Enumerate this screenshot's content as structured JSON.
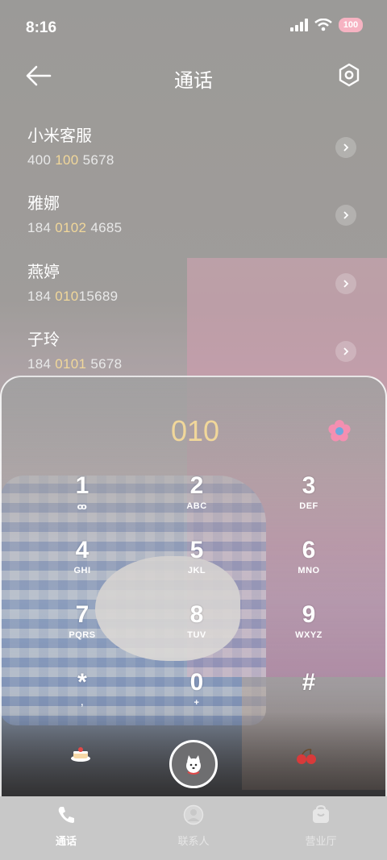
{
  "status_bar": {
    "time": "8:16",
    "battery": "100"
  },
  "header": {
    "title": "通话",
    "back_icon": "arrow-left-icon",
    "settings_icon": "settings-icon"
  },
  "contacts": [
    {
      "name": "小米客服",
      "number_parts": [
        "400 ",
        "100",
        " 5678"
      ]
    },
    {
      "name": "雅娜",
      "number_parts": [
        "184 ",
        "0102",
        " 4685"
      ]
    },
    {
      "name": "燕婷",
      "number_parts": [
        "184 ",
        "010",
        "15689"
      ]
    },
    {
      "name": "子玲",
      "number_parts": [
        "184 ",
        "0101",
        " 5678"
      ]
    }
  ],
  "dialpad": {
    "display": "010",
    "keys": [
      {
        "digit": "1",
        "letters": "ꝏ"
      },
      {
        "digit": "2",
        "letters": "ABC"
      },
      {
        "digit": "3",
        "letters": "DEF"
      },
      {
        "digit": "4",
        "letters": "GHI"
      },
      {
        "digit": "5",
        "letters": "JKL"
      },
      {
        "digit": "6",
        "letters": "MNO"
      },
      {
        "digit": "7",
        "letters": "PQRS"
      },
      {
        "digit": "8",
        "letters": "TUV"
      },
      {
        "digit": "9",
        "letters": "WXYZ"
      },
      {
        "digit": "*",
        "letters": ","
      },
      {
        "digit": "0",
        "letters": "+"
      },
      {
        "digit": "#",
        "letters": ""
      }
    ]
  },
  "tabs": [
    {
      "label": "通话",
      "icon": "phone-icon",
      "active": true
    },
    {
      "label": "联系人",
      "icon": "person-icon",
      "active": false
    },
    {
      "label": "营业厅",
      "icon": "store-icon",
      "active": false
    }
  ],
  "colors": {
    "accent": "#f1d79a",
    "tabbar": "#c8c8c8",
    "call_button": "#6e6e70"
  }
}
